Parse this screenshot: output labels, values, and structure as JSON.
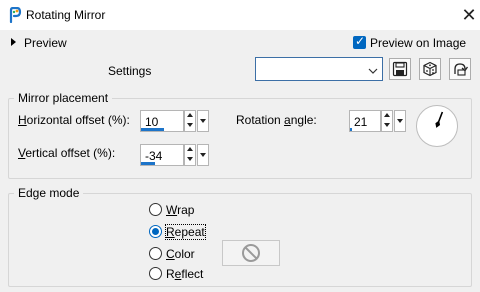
{
  "window": {
    "title": "Rotating Mirror",
    "close_glyph": "✕"
  },
  "preview": {
    "label": "Preview"
  },
  "preview_on_image": {
    "label": "Preview on Image",
    "checked": true,
    "check_glyph": "✓"
  },
  "settings": {
    "label": "Settings",
    "preset_value": ""
  },
  "mirror_placement": {
    "title": "Mirror placement",
    "horizontal_offset": {
      "label_pre": "",
      "label_u": "H",
      "label_post": "orizontal offset (%):",
      "value": "10",
      "fill": 0.55
    },
    "vertical_offset": {
      "label_pre": "",
      "label_u": "V",
      "label_post": "ertical offset (%):",
      "value": "-34",
      "fill": 0.33
    },
    "rotation_angle": {
      "label_pre": "Rotation ",
      "label_u": "a",
      "label_post": "ngle:",
      "value": "21",
      "fill": 0.06
    }
  },
  "edge_mode": {
    "title": "Edge mode",
    "options": [
      {
        "pre": "",
        "u": "W",
        "post": "rap",
        "selected": false
      },
      {
        "pre": "",
        "u": "R",
        "post": "epeat",
        "selected": true
      },
      {
        "pre": "",
        "u": "C",
        "post": "olor",
        "selected": false
      },
      {
        "pre": "R",
        "u": "e",
        "post": "flect",
        "selected": false
      }
    ]
  },
  "colors": {
    "accent": "#0067c0",
    "value_bar": "#1d74c9",
    "background": "#f0f0f0"
  }
}
